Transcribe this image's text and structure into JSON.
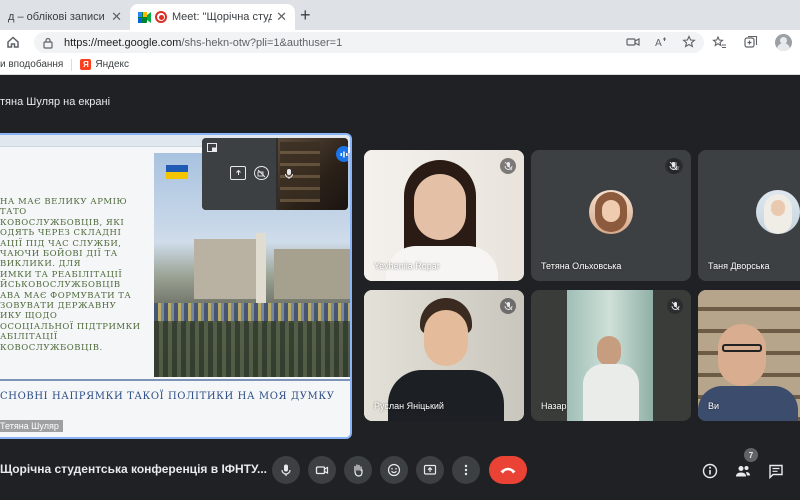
{
  "browser": {
    "tabs": [
      {
        "title": "д – облікові записи Google"
      },
      {
        "title": "Meet: \"Щорічна студентсь"
      }
    ],
    "url_main": "https://meet.google.com",
    "url_rest": "/shs-hekn-otw?pli=1&authuser=1",
    "bookmarks": [
      {
        "label": "и вподобання"
      },
      {
        "label": "Яндекс"
      }
    ],
    "colors": {
      "tabstrip": "#dee1e6",
      "accent": "#1a73e8",
      "recording": "#d93025"
    }
  },
  "meet": {
    "presenting_label": "тяна Шуляр на екрані",
    "slide": {
      "body_text": "НА МАЄ ВЕЛИКУ АРМІЮ\nТАТО\nКОВОСЛУЖБОВЦІВ, ЯКІ\nОДЯТЬ ЧЕРЕЗ СКЛАДНІ\nАЦІЇ ПІД ЧАС СЛУЖБИ,\nЧАЮЧИ БОЙОВІ ДІЇ ТА\nВИКЛИКИ. ДЛЯ\nИМКИ ТА РЕАБІЛІТАЦІЇ\nЙСЬКОВОСЛУЖБОВЦІВ\nАВА МАЄ ФОРМУВАТИ ТА\nЗОВУВАТИ ДЕРЖАВНУ\nИКУ ЩОДО\nОСОЦІАЛЬНОЇ ПІДТРИМКИ\nАБІЛІТАЦІЇ\nКОВОСЛУЖБОВЦІВ.",
      "heading": "СНОВНІ НАПРЯМКИ ТАКОЇ ПОЛІТИКИ НА МОЯ ДУМКУ",
      "presenter_name": "Тетяна Шуляр"
    },
    "participants": [
      {
        "name": "Yevheniia Ropar",
        "muted": true
      },
      {
        "name": "Тетяна Ольховська",
        "muted": true
      },
      {
        "name": "Таня Дворська",
        "muted": true
      },
      {
        "name": "Руслан Яніцький",
        "muted": true
      },
      {
        "name": "Назар",
        "muted": true
      },
      {
        "name": "Ви",
        "muted": false
      }
    ],
    "meeting_title": "Щорічна студентська конференція в ІФНТУ...",
    "people_count": "7",
    "colors": {
      "background": "#202124",
      "tile": "#3c4043",
      "hangup": "#ea4335",
      "highlight": "#8ab4f8"
    }
  }
}
